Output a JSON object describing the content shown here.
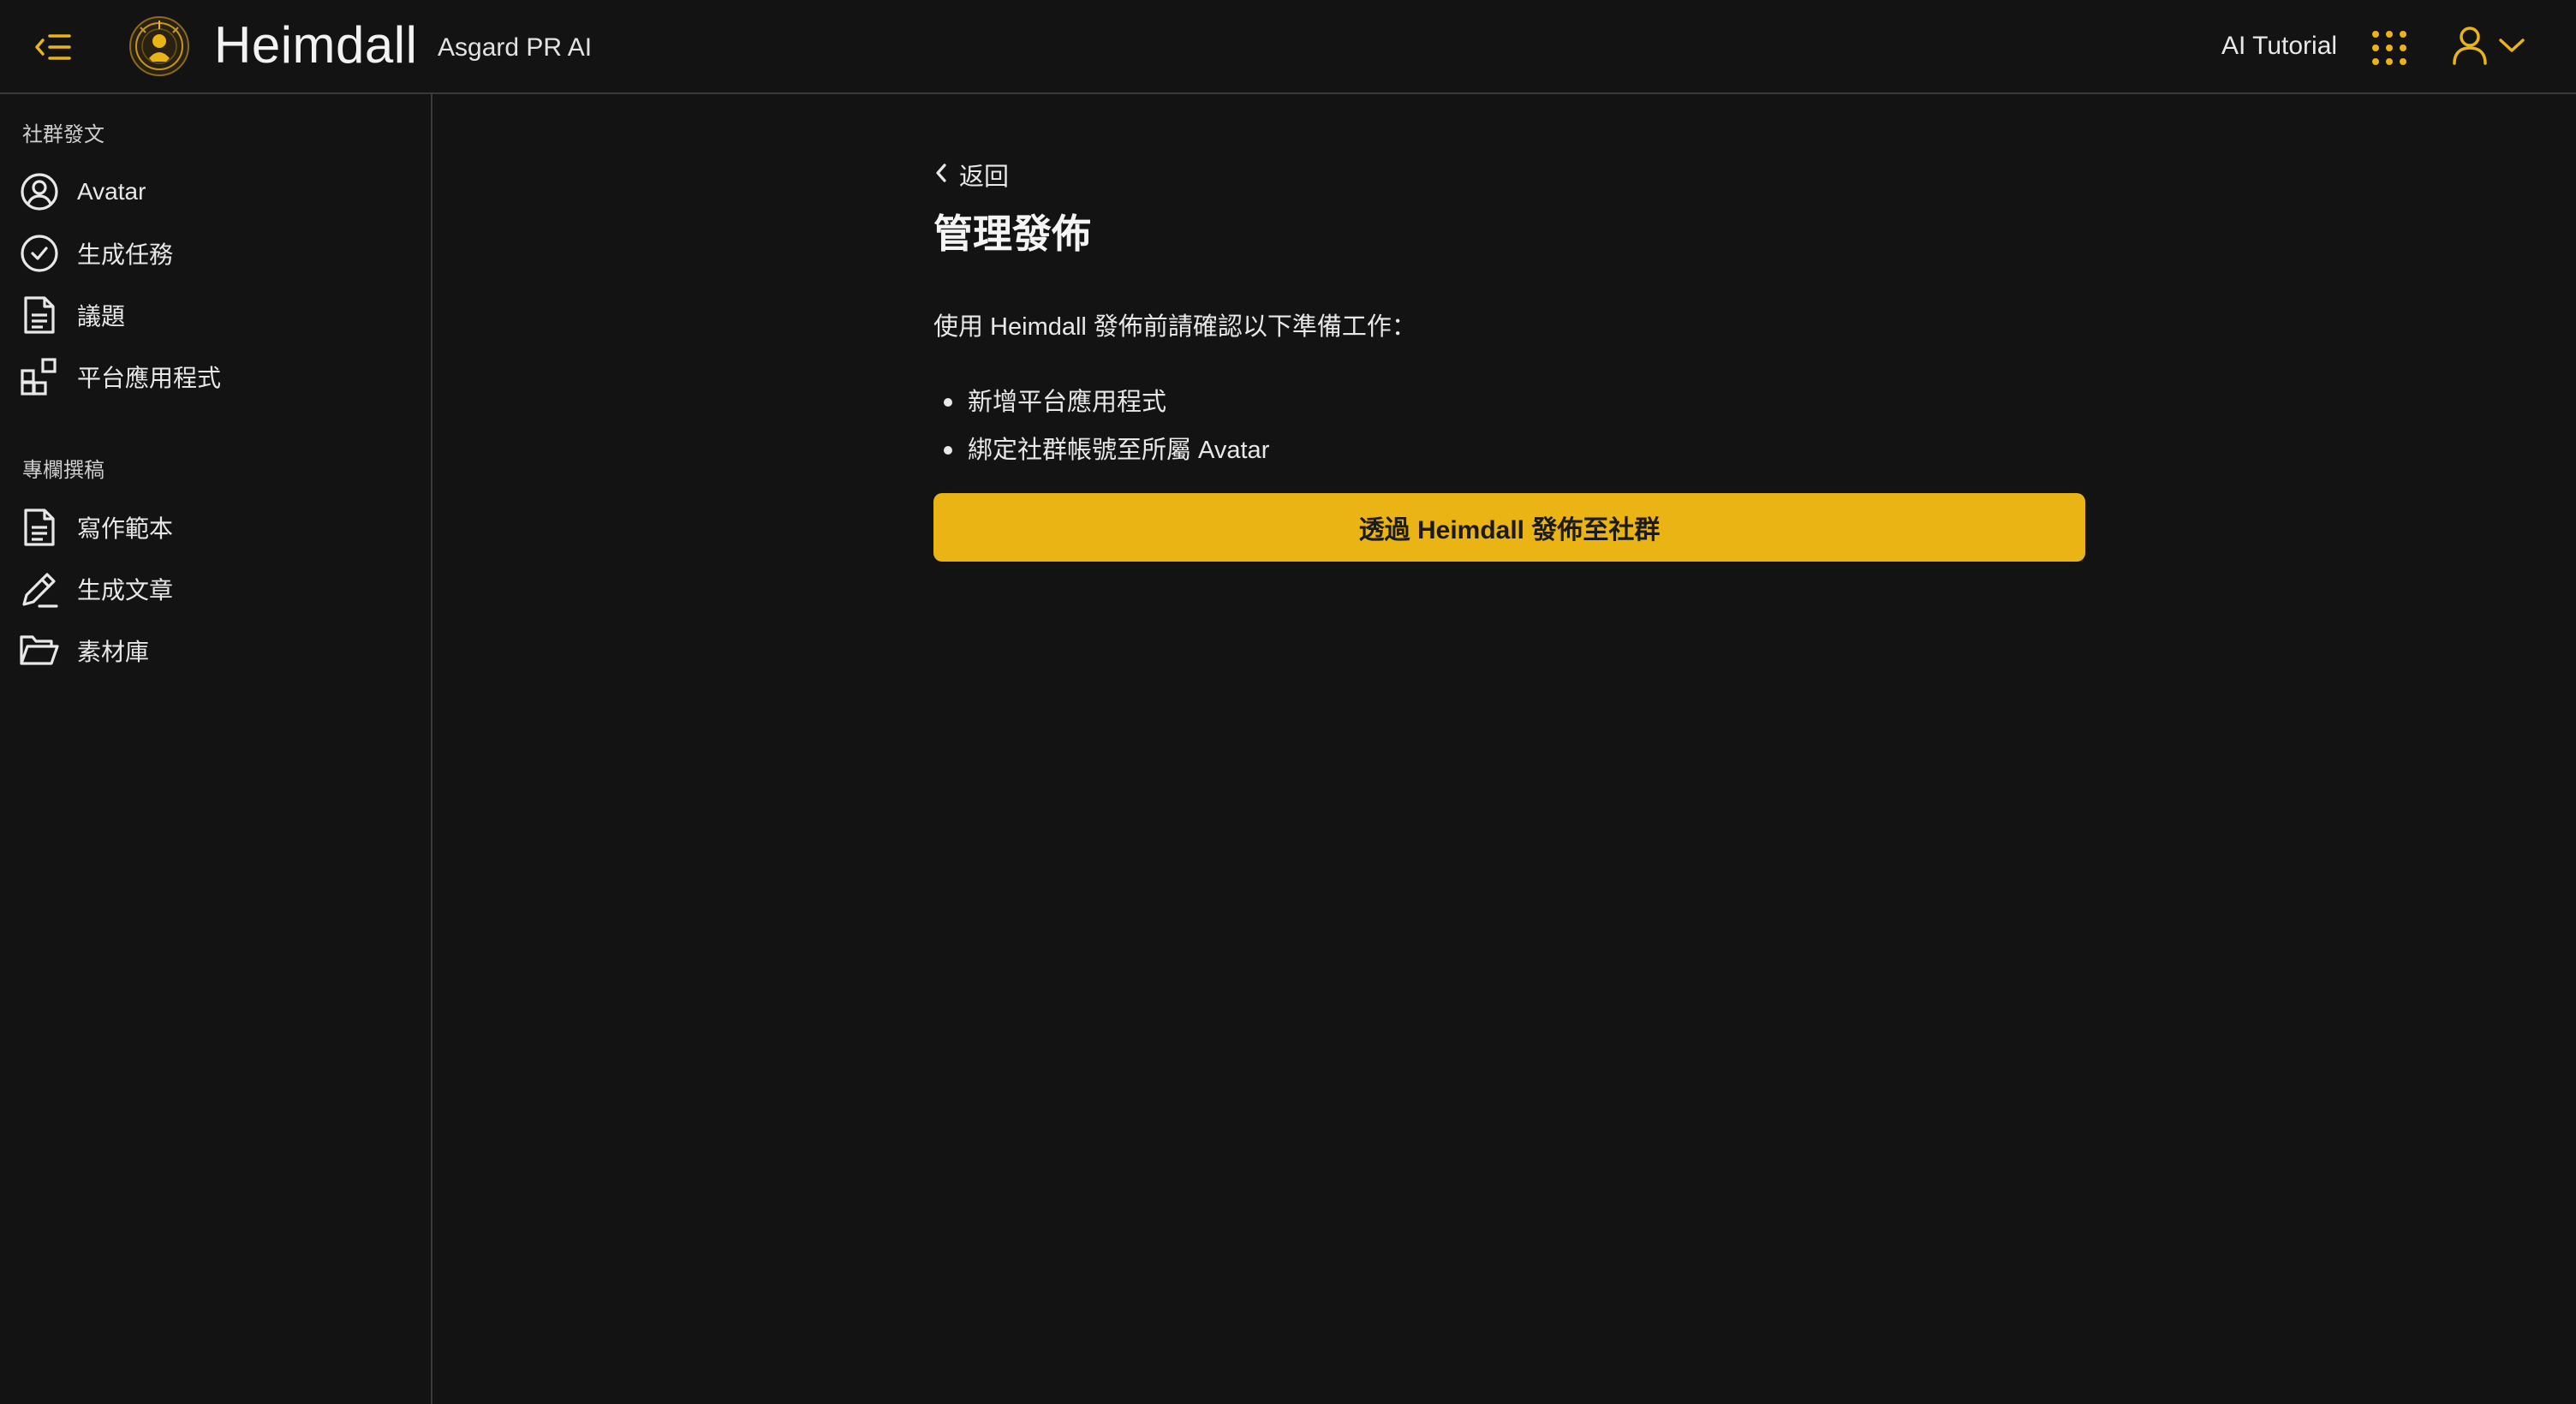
{
  "header": {
    "brand_title": "Heimdall",
    "brand_subtitle": "Asgard PR AI",
    "tutorial_label": "AI Tutorial",
    "accent_color": "#e9b414",
    "icons": [
      "menu-collapse-icon",
      "heimdall-logo",
      "apps-grid-icon",
      "user-icon",
      "chevron-down-icon"
    ]
  },
  "sidebar": {
    "sections": [
      {
        "title": "社群發文",
        "items": [
          {
            "label": "Avatar",
            "icon": "user-circle-icon"
          },
          {
            "label": "生成任務",
            "icon": "check-circle-icon"
          },
          {
            "label": "議題",
            "icon": "document-icon"
          },
          {
            "label": "平台應用程式",
            "icon": "widgets-icon"
          }
        ]
      },
      {
        "title": "專欄撰稿",
        "items": [
          {
            "label": "寫作範本",
            "icon": "document-icon"
          },
          {
            "label": "生成文章",
            "icon": "pen-icon"
          },
          {
            "label": "素材庫",
            "icon": "folder-open-icon"
          }
        ]
      }
    ]
  },
  "main": {
    "back_label": "返回",
    "title": "管理發佈",
    "intro": "使用 Heimdall 發佈前請確認以下準備工作：",
    "requirements": [
      "新增平台應用程式",
      "綁定社群帳號至所屬 Avatar"
    ],
    "publish_button": "透過 Heimdall 發佈至社群"
  }
}
